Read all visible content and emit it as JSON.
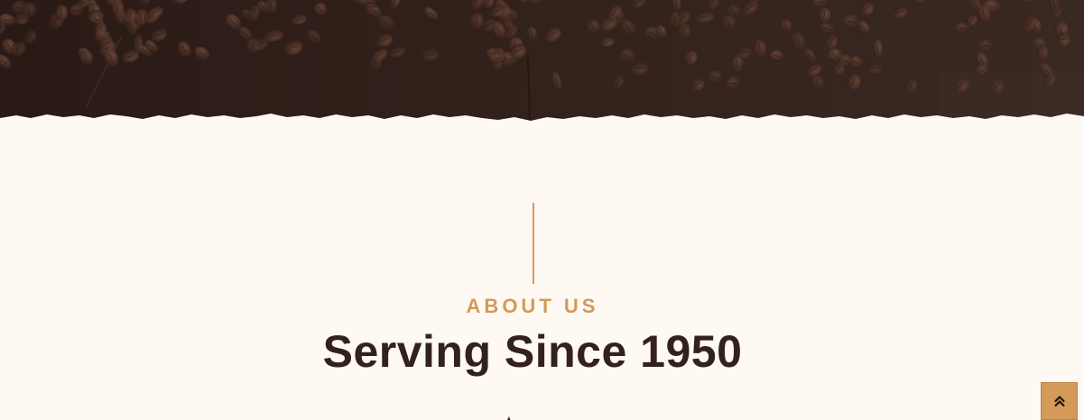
{
  "about": {
    "eyebrow": "ABOUT US",
    "heading": "Serving Since 1950"
  },
  "back_to_top": {
    "icon": "double-chevron-up-icon"
  },
  "colors": {
    "page_background": "#fff9f3",
    "accent": "#d39a5a",
    "heading_text": "#33211d",
    "hero_dark": "#2b1a16"
  }
}
